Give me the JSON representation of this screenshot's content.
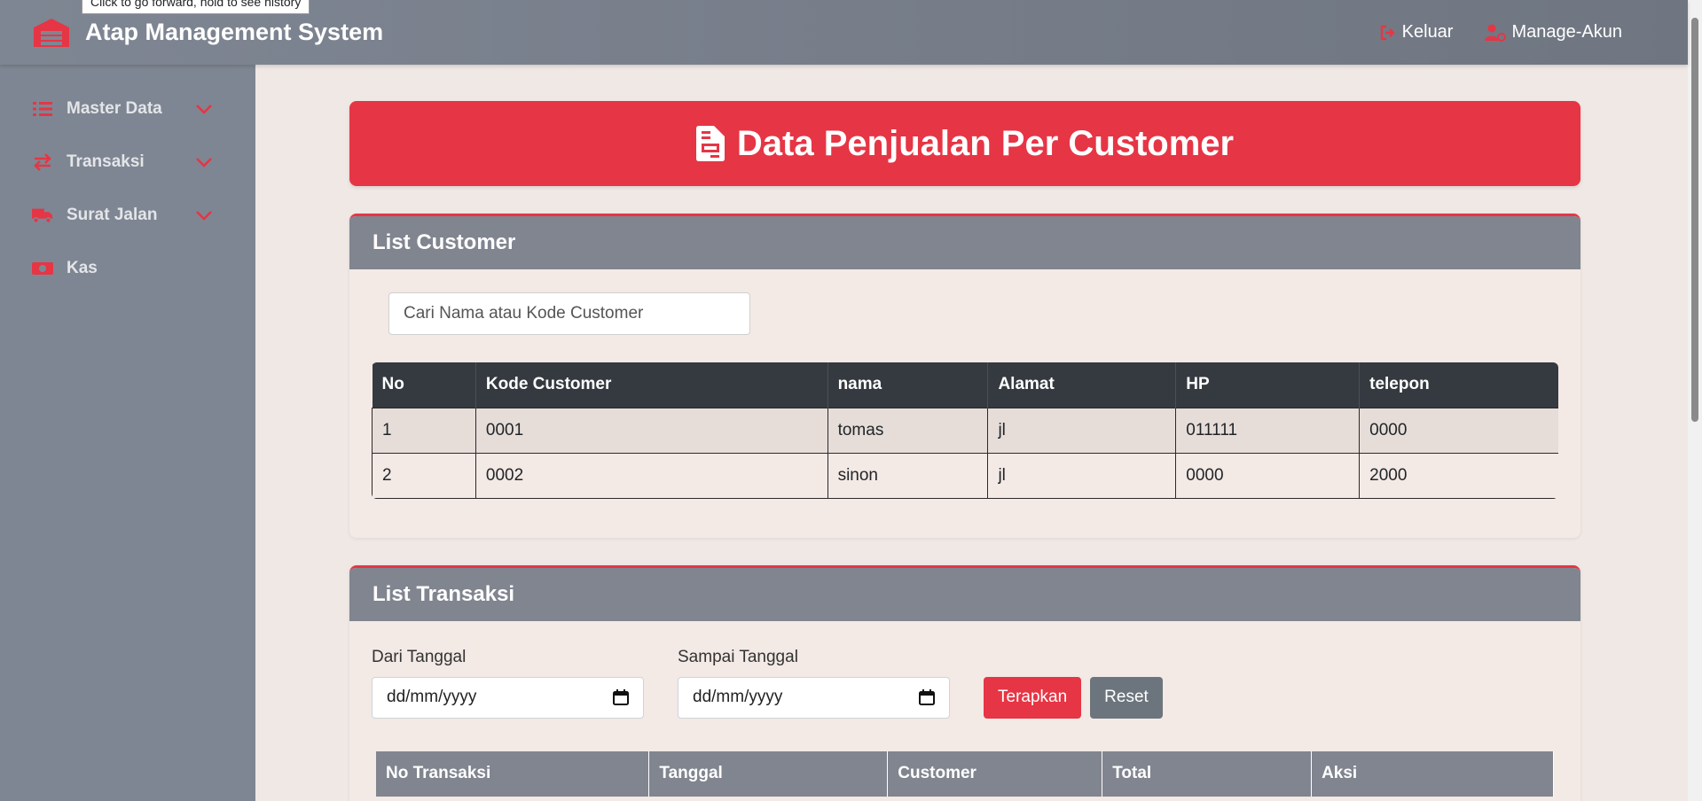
{
  "browser": {
    "tooltip": "Click to go forward, hold to see history"
  },
  "header": {
    "title": "Atap Management System",
    "logout_label": "Keluar",
    "manage_label": "Manage-Akun"
  },
  "sidebar": {
    "items": [
      {
        "label": "Master Data",
        "icon": "list-icon"
      },
      {
        "label": "Transaksi",
        "icon": "exchange-icon"
      },
      {
        "label": "Surat Jalan",
        "icon": "truck-icon"
      },
      {
        "label": "Kas",
        "icon": "money-icon"
      }
    ]
  },
  "page": {
    "title": "Data Penjualan Per Customer"
  },
  "customers": {
    "heading": "List Customer",
    "search_placeholder": "Cari Nama atau Kode Customer",
    "columns": [
      "No",
      "Kode Customer",
      "nama",
      "Alamat",
      "HP",
      "telepon"
    ],
    "rows": [
      [
        "1",
        "0001",
        "tomas",
        "jl",
        "011111",
        "0000"
      ],
      [
        "2",
        "0002",
        "sinon",
        "jl",
        "0000",
        "2000"
      ]
    ]
  },
  "transactions": {
    "heading": "List Transaksi",
    "from_label": "Dari Tanggal",
    "to_label": "Sampai Tanggal",
    "from_value": "dd/mm/yyyy",
    "to_value": "dd/mm/yyyy",
    "apply_label": "Terapkan",
    "reset_label": "Reset",
    "columns": [
      "No Transaksi",
      "Tanggal",
      "Customer",
      "Total",
      "Aksi"
    ]
  },
  "colors": {
    "accent": "#e63545",
    "sidebar": "#7f8693",
    "table_dark": "#343a40"
  }
}
